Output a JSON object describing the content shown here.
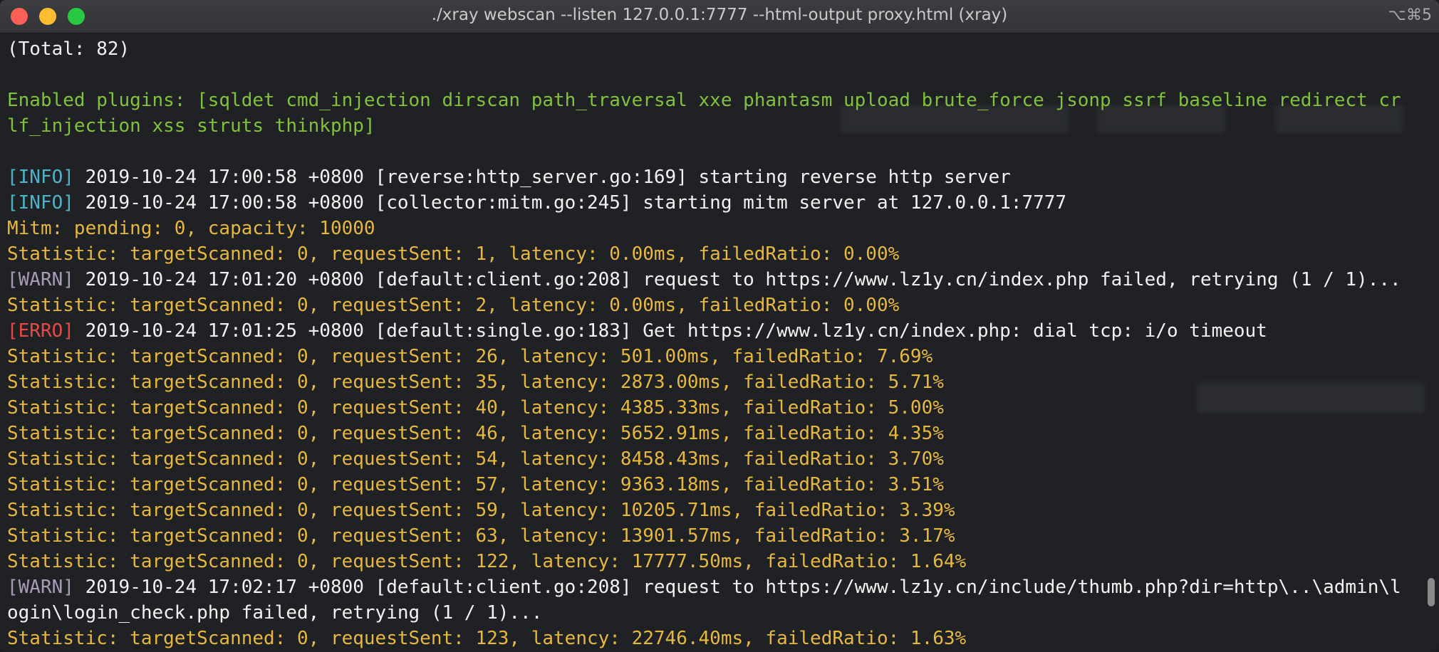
{
  "window": {
    "title": "./xray webscan --listen 127.0.0.1:7777 --html-output proxy.html (xray)",
    "shortcut": "⌥⌘5"
  },
  "terminal": {
    "lines": [
      [
        {
          "c": "white",
          "t": "(Total: 82)"
        }
      ],
      [
        {
          "c": "white",
          "t": ""
        }
      ],
      [
        {
          "c": "green",
          "t": "Enabled plugins: [sqldet cmd_injection dirscan path_traversal xxe phantasm upload brute_force jsonp ssrf baseline redirect cr"
        }
      ],
      [
        {
          "c": "green",
          "t": "lf_injection xss struts thinkphp]"
        }
      ],
      [
        {
          "c": "white",
          "t": ""
        }
      ],
      [
        {
          "c": "info",
          "t": "[INFO]"
        },
        {
          "c": "white",
          "t": " 2019-10-24 17:00:58 +0800 [reverse:http_server.go:169] starting reverse http server"
        }
      ],
      [
        {
          "c": "info",
          "t": "[INFO]"
        },
        {
          "c": "white",
          "t": " 2019-10-24 17:00:58 +0800 [collector:mitm.go:245] starting mitm server at 127.0.0.1:7777"
        }
      ],
      [
        {
          "c": "yellow",
          "t": "Mitm: pending: 0, capacity: 10000"
        }
      ],
      [
        {
          "c": "yellow",
          "t": "Statistic: targetScanned: 0, requestSent: 1, latency: 0.00ms, failedRatio: 0.00%"
        }
      ],
      [
        {
          "c": "warn",
          "t": "[WARN]"
        },
        {
          "c": "white",
          "t": " 2019-10-24 17:01:20 +0800 [default:client.go:208] request to https://www.lz1y.cn/index.php failed, retrying (1 / 1)..."
        }
      ],
      [
        {
          "c": "yellow",
          "t": "Statistic: targetScanned: 0, requestSent: 2, latency: 0.00ms, failedRatio: 0.00%"
        }
      ],
      [
        {
          "c": "erro",
          "t": "[ERRO]"
        },
        {
          "c": "white",
          "t": " 2019-10-24 17:01:25 +0800 [default:single.go:183] Get https://www.lz1y.cn/index.php: dial tcp: i/o timeout"
        }
      ],
      [
        {
          "c": "yellow",
          "t": "Statistic: targetScanned: 0, requestSent: 26, latency: 501.00ms, failedRatio: 7.69%"
        }
      ],
      [
        {
          "c": "yellow",
          "t": "Statistic: targetScanned: 0, requestSent: 35, latency: 2873.00ms, failedRatio: 5.71%"
        }
      ],
      [
        {
          "c": "yellow",
          "t": "Statistic: targetScanned: 0, requestSent: 40, latency: 4385.33ms, failedRatio: 5.00%"
        }
      ],
      [
        {
          "c": "yellow",
          "t": "Statistic: targetScanned: 0, requestSent: 46, latency: 5652.91ms, failedRatio: 4.35%"
        }
      ],
      [
        {
          "c": "yellow",
          "t": "Statistic: targetScanned: 0, requestSent: 54, latency: 8458.43ms, failedRatio: 3.70%"
        }
      ],
      [
        {
          "c": "yellow",
          "t": "Statistic: targetScanned: 0, requestSent: 57, latency: 9363.18ms, failedRatio: 3.51%"
        }
      ],
      [
        {
          "c": "yellow",
          "t": "Statistic: targetScanned: 0, requestSent: 59, latency: 10205.71ms, failedRatio: 3.39%"
        }
      ],
      [
        {
          "c": "yellow",
          "t": "Statistic: targetScanned: 0, requestSent: 63, latency: 13901.57ms, failedRatio: 3.17%"
        }
      ],
      [
        {
          "c": "yellow",
          "t": "Statistic: targetScanned: 0, requestSent: 122, latency: 17777.50ms, failedRatio: 1.64%"
        }
      ],
      [
        {
          "c": "warn",
          "t": "[WARN]"
        },
        {
          "c": "white",
          "t": " 2019-10-24 17:02:17 +0800 [default:client.go:208] request to https://www.lz1y.cn/include/thumb.php?dir=http\\..\\admin\\l"
        }
      ],
      [
        {
          "c": "white",
          "t": "ogin\\login_check.php failed, retrying (1 / 1)..."
        }
      ],
      [
        {
          "c": "yellow",
          "t": "Statistic: targetScanned: 0, requestSent: 123, latency: 22746.40ms, failedRatio: 1.63%"
        }
      ]
    ]
  }
}
